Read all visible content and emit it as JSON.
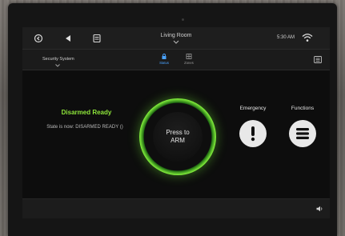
{
  "topbar": {
    "room": "Living Room",
    "time": "5:30 AM"
  },
  "subbar": {
    "system": "Security System",
    "tabs": [
      {
        "label": "Status",
        "active": true
      },
      {
        "label": "Zones",
        "active": false
      }
    ]
  },
  "status": {
    "title": "Disarmed Ready",
    "detail": "State is now: DISARMED READY ()"
  },
  "arm_button": {
    "line1": "Press to",
    "line2": "ARM"
  },
  "actions": {
    "emergency": "Emergency",
    "functions": "Functions"
  },
  "colors": {
    "status_green": "#8ee63a",
    "ring_green": "#7eea3a",
    "active_tab": "#4aa3ff"
  },
  "icons": {
    "back": "back-icon",
    "previous": "previous-arrow-icon",
    "remote": "remote-icon",
    "wifi": "wifi-icon",
    "status_tab": "lock-icon",
    "zones_tab": "grid-icon",
    "menu": "menu-icon",
    "emergency": "exclamation-icon",
    "functions": "list-icon",
    "volume": "volume-icon"
  }
}
